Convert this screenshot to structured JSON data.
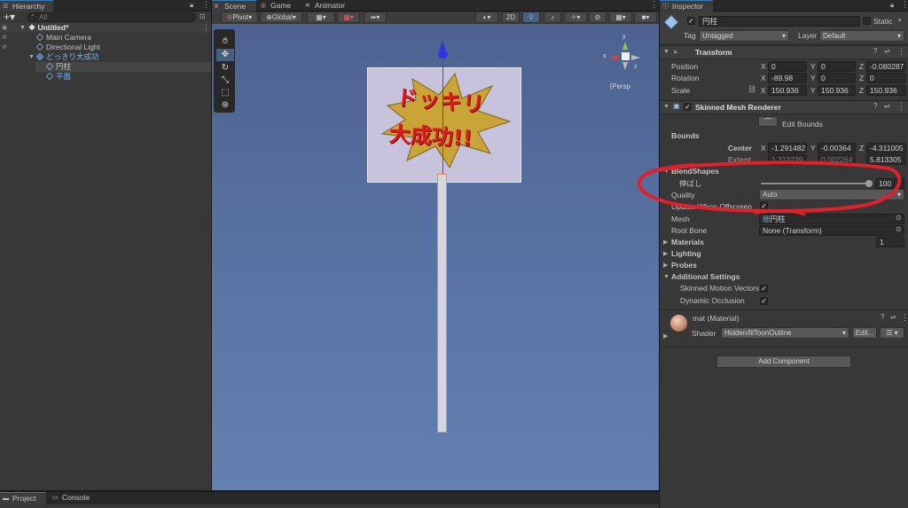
{
  "hierarchy": {
    "tab": "Hierarchy",
    "search_placeholder": "All",
    "scene": "Untitled*",
    "items": [
      "Main Camera",
      "Directional Light",
      "どっきり大成功",
      "円柱",
      "平面"
    ]
  },
  "scene_tabs": [
    "Scene",
    "Game",
    "Animator"
  ],
  "scene_toolbar": {
    "pivot": "Pivot",
    "global": "Global",
    "two_d": "2D"
  },
  "gizmo": {
    "label": "Persp",
    "axis_x": "x",
    "axis_y": "y",
    "axis_z": "z"
  },
  "sign": {
    "line1": "ドッキリ",
    "line2": "大成功!!"
  },
  "bottom_tabs": [
    "Project",
    "Console"
  ],
  "inspector": {
    "tab": "Inspector",
    "object_name": "円柱",
    "static_label": "Static",
    "tag_label": "Tag",
    "tag_value": "Untagged",
    "layer_label": "Layer",
    "layer_value": "Default",
    "transform": {
      "title": "Transform",
      "position_label": "Position",
      "rotation_label": "Rotation",
      "scale_label": "Scale",
      "position": [
        "0",
        "0",
        "-0.080287"
      ],
      "rotation": [
        "-89.98",
        "0",
        "0"
      ],
      "scale": [
        "150.936",
        "150.936",
        "150.936"
      ],
      "axes": [
        "X",
        "Y",
        "Z"
      ]
    },
    "renderer": {
      "title": "Skinned Mesh Renderer",
      "edit_bounds": "Edit Bounds",
      "bounds_label": "Bounds",
      "center_label": "Center",
      "center": [
        "-1.291482",
        "-0.00364",
        "-4.311005"
      ],
      "extent_label": "Extent",
      "extent": [
        "1.313239",
        "0.002264",
        "5.813305"
      ],
      "blendshapes_label": "BlendShapes",
      "blend_name": "伸ばし",
      "blend_value": "100",
      "blend_level": 1.0,
      "quality_label": "Quality",
      "quality_value": "Auto",
      "update_offscreen_label": "Update When Offscreen",
      "mesh_label": "Mesh",
      "mesh_value": "円柱",
      "root_bone_label": "Root Bone",
      "root_bone_value": "None (Transform)",
      "materials_label": "Materials",
      "materials_count": "1",
      "lighting_label": "Lighting",
      "probes_label": "Probes",
      "additional_label": "Additional Settings",
      "skinned_motion_label": "Skinned Motion Vectors",
      "dynamic_occlusion_label": "Dynamic Occlusion"
    },
    "material": {
      "title": "mat (Material)",
      "shader_label": "Shader",
      "shader_value": "Hidden/lilToonOutline",
      "edit_label": "Edit..."
    },
    "add_component": "Add Component"
  },
  "colors": {
    "accent": "#3a79bb",
    "annotation_red": "#e0202a",
    "scene_sky": "#5b78a8"
  }
}
